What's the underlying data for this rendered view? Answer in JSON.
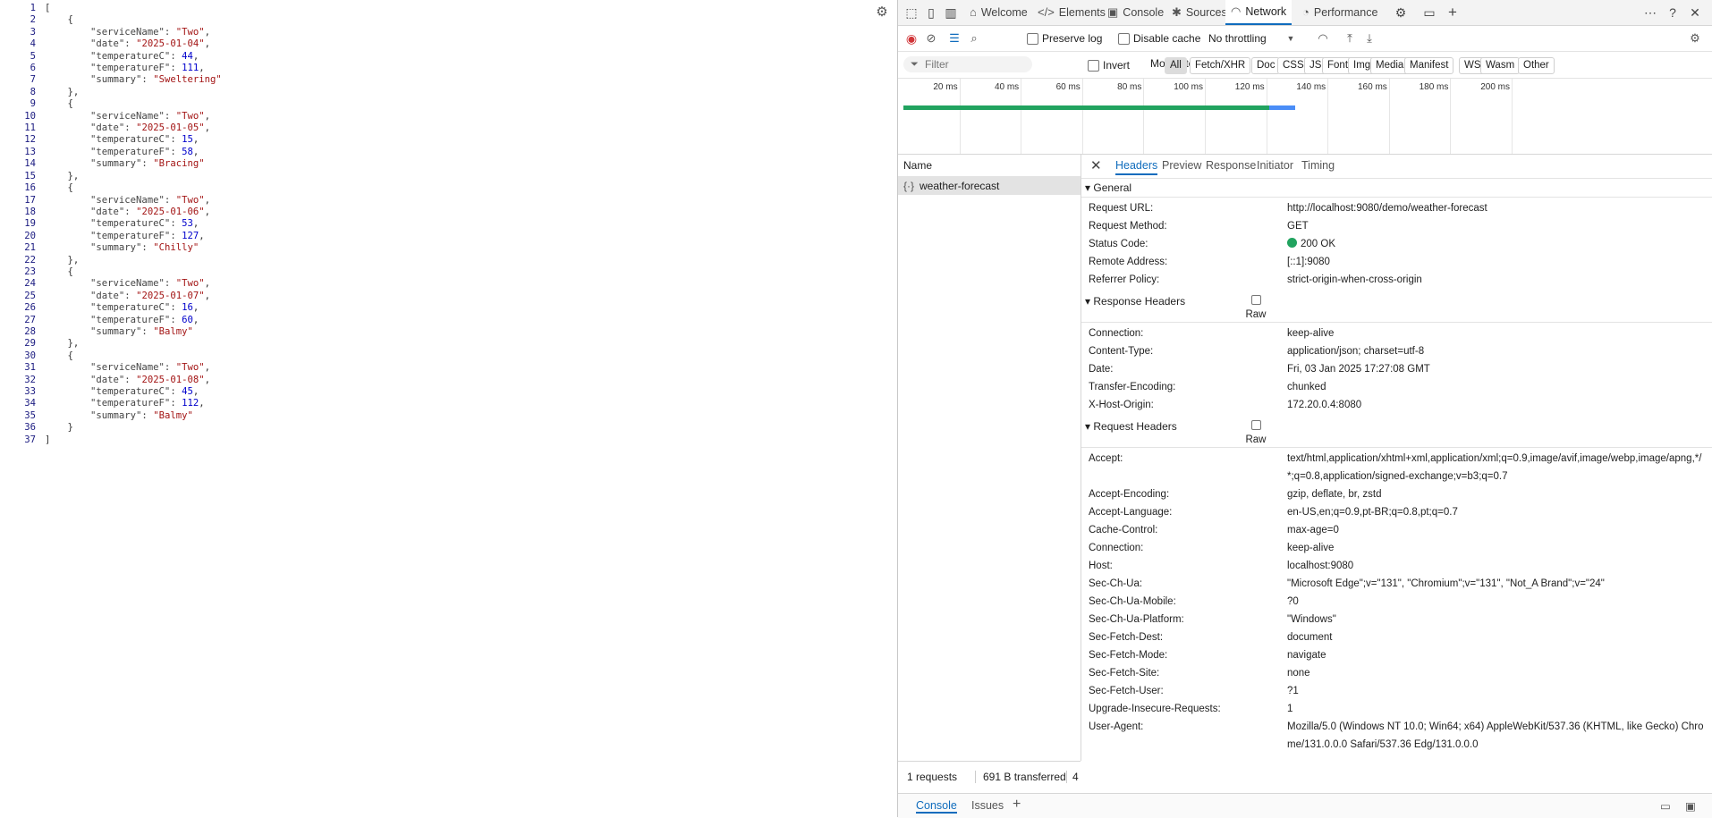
{
  "code_lines": [
    {
      "no": "1",
      "parts": [
        {
          "t": "[",
          "c": "p"
        }
      ]
    },
    {
      "no": "2",
      "parts": [
        {
          "t": "    {",
          "c": "p"
        }
      ]
    },
    {
      "no": "3",
      "parts": [
        {
          "t": "        \"serviceName\": ",
          "c": "k"
        },
        {
          "t": "\"Two\"",
          "c": "s"
        },
        {
          "t": ",",
          "c": "p"
        }
      ]
    },
    {
      "no": "4",
      "parts": [
        {
          "t": "        \"date\": ",
          "c": "k"
        },
        {
          "t": "\"2025-01-04\"",
          "c": "s"
        },
        {
          "t": ",",
          "c": "p"
        }
      ]
    },
    {
      "no": "5",
      "parts": [
        {
          "t": "        \"temperatureC\": ",
          "c": "k"
        },
        {
          "t": "44",
          "c": "n"
        },
        {
          "t": ",",
          "c": "p"
        }
      ]
    },
    {
      "no": "6",
      "parts": [
        {
          "t": "        \"temperatureF\": ",
          "c": "k"
        },
        {
          "t": "111",
          "c": "n"
        },
        {
          "t": ",",
          "c": "p"
        }
      ]
    },
    {
      "no": "7",
      "parts": [
        {
          "t": "        \"summary\": ",
          "c": "k"
        },
        {
          "t": "\"Sweltering\"",
          "c": "s"
        }
      ]
    },
    {
      "no": "8",
      "parts": [
        {
          "t": "    },",
          "c": "p"
        }
      ]
    },
    {
      "no": "9",
      "parts": [
        {
          "t": "    {",
          "c": "p"
        }
      ]
    },
    {
      "no": "10",
      "parts": [
        {
          "t": "        \"serviceName\": ",
          "c": "k"
        },
        {
          "t": "\"Two\"",
          "c": "s"
        },
        {
          "t": ",",
          "c": "p"
        }
      ]
    },
    {
      "no": "11",
      "parts": [
        {
          "t": "        \"date\": ",
          "c": "k"
        },
        {
          "t": "\"2025-01-05\"",
          "c": "s"
        },
        {
          "t": ",",
          "c": "p"
        }
      ]
    },
    {
      "no": "12",
      "parts": [
        {
          "t": "        \"temperatureC\": ",
          "c": "k"
        },
        {
          "t": "15",
          "c": "n"
        },
        {
          "t": ",",
          "c": "p"
        }
      ]
    },
    {
      "no": "13",
      "parts": [
        {
          "t": "        \"temperatureF\": ",
          "c": "k"
        },
        {
          "t": "58",
          "c": "n"
        },
        {
          "t": ",",
          "c": "p"
        }
      ]
    },
    {
      "no": "14",
      "parts": [
        {
          "t": "        \"summary\": ",
          "c": "k"
        },
        {
          "t": "\"Bracing\"",
          "c": "s"
        }
      ]
    },
    {
      "no": "15",
      "parts": [
        {
          "t": "    },",
          "c": "p"
        }
      ]
    },
    {
      "no": "16",
      "parts": [
        {
          "t": "    {",
          "c": "p"
        }
      ]
    },
    {
      "no": "17",
      "parts": [
        {
          "t": "        \"serviceName\": ",
          "c": "k"
        },
        {
          "t": "\"Two\"",
          "c": "s"
        },
        {
          "t": ",",
          "c": "p"
        }
      ]
    },
    {
      "no": "18",
      "parts": [
        {
          "t": "        \"date\": ",
          "c": "k"
        },
        {
          "t": "\"2025-01-06\"",
          "c": "s"
        },
        {
          "t": ",",
          "c": "p"
        }
      ]
    },
    {
      "no": "19",
      "parts": [
        {
          "t": "        \"temperatureC\": ",
          "c": "k"
        },
        {
          "t": "53",
          "c": "n"
        },
        {
          "t": ",",
          "c": "p"
        }
      ]
    },
    {
      "no": "20",
      "parts": [
        {
          "t": "        \"temperatureF\": ",
          "c": "k"
        },
        {
          "t": "127",
          "c": "n"
        },
        {
          "t": ",",
          "c": "p"
        }
      ]
    },
    {
      "no": "21",
      "parts": [
        {
          "t": "        \"summary\": ",
          "c": "k"
        },
        {
          "t": "\"Chilly\"",
          "c": "s"
        }
      ]
    },
    {
      "no": "22",
      "parts": [
        {
          "t": "    },",
          "c": "p"
        }
      ]
    },
    {
      "no": "23",
      "parts": [
        {
          "t": "    {",
          "c": "p"
        }
      ]
    },
    {
      "no": "24",
      "parts": [
        {
          "t": "        \"serviceName\": ",
          "c": "k"
        },
        {
          "t": "\"Two\"",
          "c": "s"
        },
        {
          "t": ",",
          "c": "p"
        }
      ]
    },
    {
      "no": "25",
      "parts": [
        {
          "t": "        \"date\": ",
          "c": "k"
        },
        {
          "t": "\"2025-01-07\"",
          "c": "s"
        },
        {
          "t": ",",
          "c": "p"
        }
      ]
    },
    {
      "no": "26",
      "parts": [
        {
          "t": "        \"temperatureC\": ",
          "c": "k"
        },
        {
          "t": "16",
          "c": "n"
        },
        {
          "t": ",",
          "c": "p"
        }
      ]
    },
    {
      "no": "27",
      "parts": [
        {
          "t": "        \"temperatureF\": ",
          "c": "k"
        },
        {
          "t": "60",
          "c": "n"
        },
        {
          "t": ",",
          "c": "p"
        }
      ]
    },
    {
      "no": "28",
      "parts": [
        {
          "t": "        \"summary\": ",
          "c": "k"
        },
        {
          "t": "\"Balmy\"",
          "c": "s"
        }
      ]
    },
    {
      "no": "29",
      "parts": [
        {
          "t": "    },",
          "c": "p"
        }
      ]
    },
    {
      "no": "30",
      "parts": [
        {
          "t": "    {",
          "c": "p"
        }
      ]
    },
    {
      "no": "31",
      "parts": [
        {
          "t": "        \"serviceName\": ",
          "c": "k"
        },
        {
          "t": "\"Two\"",
          "c": "s"
        },
        {
          "t": ",",
          "c": "p"
        }
      ]
    },
    {
      "no": "32",
      "parts": [
        {
          "t": "        \"date\": ",
          "c": "k"
        },
        {
          "t": "\"2025-01-08\"",
          "c": "s"
        },
        {
          "t": ",",
          "c": "p"
        }
      ]
    },
    {
      "no": "33",
      "parts": [
        {
          "t": "        \"temperatureC\": ",
          "c": "k"
        },
        {
          "t": "45",
          "c": "n"
        },
        {
          "t": ",",
          "c": "p"
        }
      ]
    },
    {
      "no": "34",
      "parts": [
        {
          "t": "        \"temperatureF\": ",
          "c": "k"
        },
        {
          "t": "112",
          "c": "n"
        },
        {
          "t": ",",
          "c": "p"
        }
      ]
    },
    {
      "no": "35",
      "parts": [
        {
          "t": "        \"summary\": ",
          "c": "k"
        },
        {
          "t": "\"Balmy\"",
          "c": "s"
        }
      ]
    },
    {
      "no": "36",
      "parts": [
        {
          "t": "    }",
          "c": "p"
        }
      ]
    },
    {
      "no": "37",
      "parts": [
        {
          "t": "]",
          "c": "p"
        }
      ]
    }
  ],
  "devtools": {
    "tabs": [
      "Welcome",
      "Elements",
      "Console",
      "Sources",
      "Network",
      "Performance"
    ],
    "active_tab": "Network",
    "toolbar": {
      "preserve_log": "Preserve log",
      "disable_cache": "Disable cache",
      "throttling": "No throttling"
    },
    "filter": {
      "placeholder": "Filter",
      "invert": "Invert",
      "more_filters": "More filters",
      "types": [
        "All",
        "Fetch/XHR",
        "Doc",
        "CSS",
        "JS",
        "Font",
        "Img",
        "Media",
        "Manifest",
        "WS",
        "Wasm",
        "Other"
      ]
    },
    "timeline": {
      "ticks": [
        "20 ms",
        "40 ms",
        "60 ms",
        "80 ms",
        "100 ms",
        "120 ms",
        "140 ms",
        "160 ms",
        "180 ms",
        "200 ms"
      ],
      "bar_green_end_ms": 121,
      "bar_blue_end_ms": 126
    },
    "names_header": "Name",
    "requests": [
      {
        "name": "weather-forecast"
      }
    ],
    "detail_tabs": [
      "Headers",
      "Preview",
      "Response",
      "Initiator",
      "Timing"
    ],
    "active_detail_tab": "Headers",
    "general": {
      "title": "General",
      "rows": [
        {
          "k": "Request URL:",
          "v": "http://localhost:9080/demo/weather-forecast"
        },
        {
          "k": "Request Method:",
          "v": "GET"
        },
        {
          "k": "Status Code:",
          "v": "200 OK"
        },
        {
          "k": "Remote Address:",
          "v": "[::1]:9080"
        },
        {
          "k": "Referrer Policy:",
          "v": "strict-origin-when-cross-origin"
        }
      ]
    },
    "response_headers": {
      "title": "Response Headers",
      "raw": "Raw",
      "rows": [
        {
          "k": "Connection:",
          "v": "keep-alive"
        },
        {
          "k": "Content-Type:",
          "v": "application/json; charset=utf-8"
        },
        {
          "k": "Date:",
          "v": "Fri, 03 Jan 2025 17:27:08 GMT"
        },
        {
          "k": "Transfer-Encoding:",
          "v": "chunked"
        },
        {
          "k": "X-Host-Origin:",
          "v": "172.20.0.4:8080"
        }
      ]
    },
    "request_headers": {
      "title": "Request Headers",
      "raw": "Raw",
      "rows": [
        {
          "k": "Accept:",
          "v": "text/html,application/xhtml+xml,application/xml;q=0.9,image/avif,image/webp,image/apng,*/*;q=0.8,application/signed-exchange;v=b3;q=0.7"
        },
        {
          "k": "Accept-Encoding:",
          "v": "gzip, deflate, br, zstd"
        },
        {
          "k": "Accept-Language:",
          "v": "en-US,en;q=0.9,pt-BR;q=0.8,pt;q=0.7"
        },
        {
          "k": "Cache-Control:",
          "v": "max-age=0"
        },
        {
          "k": "Connection:",
          "v": "keep-alive"
        },
        {
          "k": "Host:",
          "v": "localhost:9080"
        },
        {
          "k": "Sec-Ch-Ua:",
          "v": "\"Microsoft Edge\";v=\"131\", \"Chromium\";v=\"131\", \"Not_A Brand\";v=\"24\""
        },
        {
          "k": "Sec-Ch-Ua-Mobile:",
          "v": "?0"
        },
        {
          "k": "Sec-Ch-Ua-Platform:",
          "v": "\"Windows\""
        },
        {
          "k": "Sec-Fetch-Dest:",
          "v": "document"
        },
        {
          "k": "Sec-Fetch-Mode:",
          "v": "navigate"
        },
        {
          "k": "Sec-Fetch-Site:",
          "v": "none"
        },
        {
          "k": "Sec-Fetch-User:",
          "v": "?1"
        },
        {
          "k": "Upgrade-Insecure-Requests:",
          "v": "1"
        },
        {
          "k": "User-Agent:",
          "v": "Mozilla/5.0 (Windows NT 10.0; Win64; x64) AppleWebKit/537.36 (KHTML, like Gecko) Chrome/131.0.0.0 Safari/537.36 Edg/131.0.0.0"
        }
      ]
    },
    "status": {
      "requests": "1 requests",
      "transferred": "691 B transferred",
      "extra": "4"
    },
    "drawer": {
      "tabs": [
        "Console",
        "Issues"
      ]
    }
  }
}
